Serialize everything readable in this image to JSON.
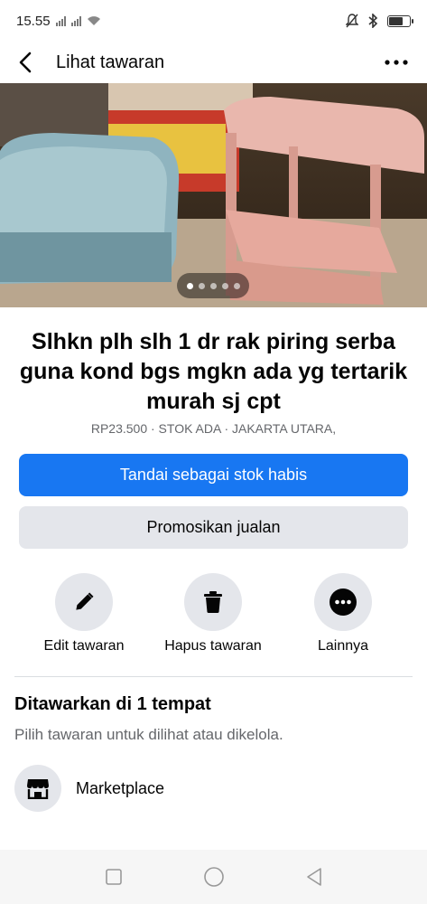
{
  "status_bar": {
    "time": "15.55",
    "battery_level": 0.7
  },
  "header": {
    "title": "Lihat tawaran"
  },
  "photo": {
    "carousel_count": 5,
    "carousel_active": 0
  },
  "listing": {
    "title": "Slhkn plh slh 1 dr rak piring serba guna kond bgs mgkn ada yg tertarik murah sj cpt",
    "meta": "RP23.500 · STOK ADA · JAKARTA UTARA,"
  },
  "buttons": {
    "mark_sold": "Tandai sebagai stok habis",
    "promote": "Promosikan jualan"
  },
  "actions": {
    "edit": "Edit tawaran",
    "delete": "Hapus tawaran",
    "more": "Lainnya"
  },
  "offered": {
    "title": "Ditawarkan di 1 tempat",
    "subtitle": "Pilih tawaran untuk dilihat atau dikelola.",
    "places": [
      {
        "label": "Marketplace",
        "icon": "storefront-icon"
      }
    ]
  },
  "colors": {
    "primary": "#1877f2",
    "secondary_bg": "#e4e6eb",
    "muted_text": "#65676b"
  }
}
